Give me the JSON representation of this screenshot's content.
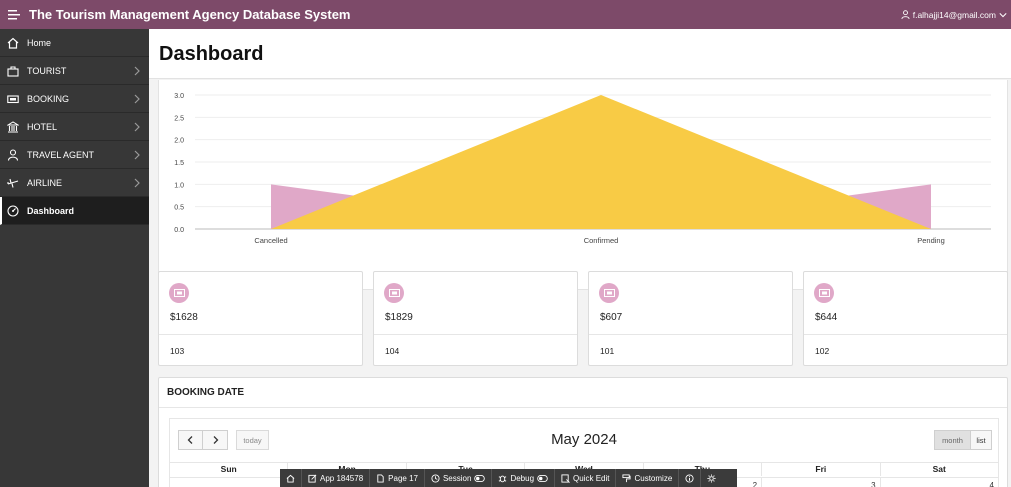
{
  "header": {
    "app_title": "The Tourism Management Agency Database System",
    "user_email": "f.alhajji14@gmail.com"
  },
  "sidebar": {
    "items": [
      {
        "label": "Home",
        "icon": "home-icon"
      },
      {
        "label": "TOURIST",
        "icon": "suitcase-icon"
      },
      {
        "label": "BOOKING",
        "icon": "ticket-icon"
      },
      {
        "label": "HOTEL",
        "icon": "building-icon"
      },
      {
        "label": "TRAVEL AGENT",
        "icon": "user-icon"
      },
      {
        "label": "AIRLINE",
        "icon": "plane-icon"
      },
      {
        "label": "Dashboard",
        "icon": "dashboard-icon"
      }
    ]
  },
  "page": {
    "title": "Dashboard"
  },
  "chart_data": {
    "type": "area",
    "categories": [
      "Cancelled",
      "Confirmed",
      "Pending"
    ],
    "series": [
      {
        "values": [
          1,
          0,
          1
        ],
        "color": "#e0a8c8"
      },
      {
        "values": [
          0,
          3,
          0
        ],
        "color": "#f8cb45"
      }
    ],
    "yticks": [
      "0.0",
      "0.5",
      "1.0",
      "1.5",
      "2.0",
      "2.5",
      "3.0"
    ],
    "ylim": [
      0,
      3
    ],
    "grid": true
  },
  "stats": [
    {
      "value": "$1628",
      "id": "103"
    },
    {
      "value": "$1829",
      "id": "104"
    },
    {
      "value": "$607",
      "id": "101"
    },
    {
      "value": "$644",
      "id": "102"
    }
  ],
  "calendar": {
    "region_title": "BOOKING DATE",
    "month_title": "May 2024",
    "today_label": "today",
    "month_label": "month",
    "list_label": "list",
    "days_of_week": [
      "Sun",
      "Mon",
      "Tue",
      "Wed",
      "Thu",
      "Fri",
      "Sat"
    ],
    "first_row": [
      "",
      "",
      "",
      "",
      "2",
      "3",
      "4"
    ]
  },
  "devbar": {
    "app": "App 184578",
    "page": "Page 17",
    "session": "Session",
    "debug": "Debug",
    "quick_edit": "Quick Edit",
    "customize": "Customize"
  },
  "colors": {
    "header": "#7d4a69",
    "sidebar": "#373737",
    "accent_pink": "#e0a8c8",
    "accent_yellow": "#f8cb45"
  }
}
